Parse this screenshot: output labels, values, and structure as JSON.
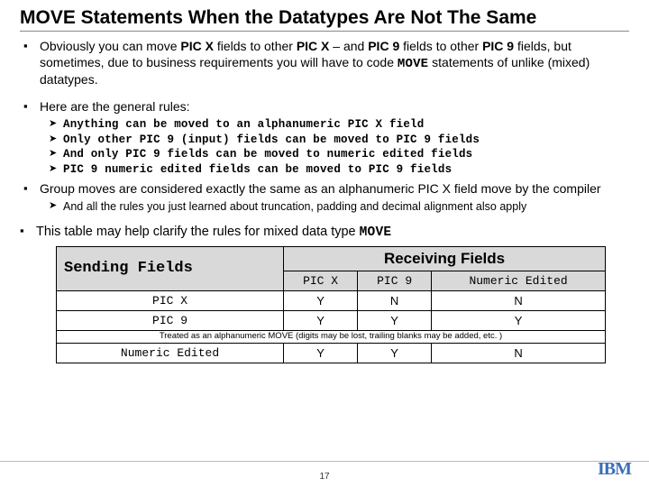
{
  "title": "MOVE Statements When the Datatypes Are Not The Same",
  "b1": {
    "p1": "Obviously you can move ",
    "p2": " fields to other ",
    "p3": " – and ",
    "p4": " fields to other ",
    "p5": " fields, but sometimes, due to business requirements you will have to code ",
    "p6": " statements of unlike (mixed) datatypes.",
    "picx": "PIC X",
    "pic9": "PIC 9",
    "move": "MOVE"
  },
  "b2": "Here are the general rules:",
  "rules": [
    "Anything can be moved to an alphanumeric PIC X field",
    "Only other PIC 9 (input) fields can be moved to PIC 9 fields",
    "And only PIC 9 fields can be moved to numeric edited fields",
    "PIC 9 numeric edited fields can be moved to PIC 9 fields"
  ],
  "b3": "Group moves are considered exactly the same as an alphanumeric PIC X field move by the compiler",
  "b3sub": "And all the rules you just learned about truncation, padding and decimal alignment also apply",
  "b4": {
    "p1": "This table may help clarify the rules for mixed data type ",
    "move": "MOVE"
  },
  "table": {
    "sending": "Sending Fields",
    "receiving": "Receiving Fields",
    "cols": {
      "c1": "PIC X",
      "c2": "PIC 9",
      "c3": "Numeric Edited"
    },
    "rows": {
      "r1": {
        "h": "PIC X",
        "c1": "Y",
        "c2": "N",
        "c3": "N"
      },
      "r2": {
        "h": "PIC 9",
        "c1": "Y",
        "c2": "Y",
        "c3": "Y"
      },
      "note": "Treated as an alphanumeric MOVE (digits may be lost, trailing blanks may be added, etc. )",
      "r3": {
        "h": "Numeric Edited",
        "c1": "Y",
        "c2": "Y",
        "c3": "N"
      }
    }
  },
  "page": "17",
  "logo": "IBM"
}
